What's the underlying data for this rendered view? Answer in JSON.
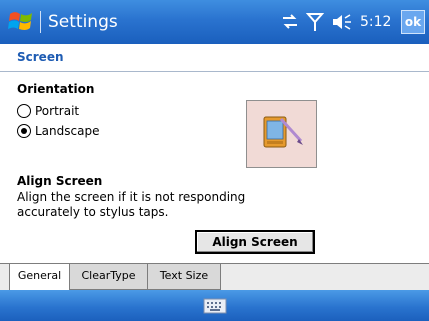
{
  "titlebar": {
    "title": "Settings",
    "time": "5:12",
    "ok_label": "ok",
    "icons": [
      "windows-flag-icon",
      "sync-icon",
      "signal-icon",
      "speaker-icon"
    ],
    "colors": {
      "bar": "#2a73cf",
      "text": "#ffffff"
    }
  },
  "page": {
    "header": "Screen"
  },
  "orientation": {
    "heading": "Orientation",
    "options": [
      {
        "label": "Portrait",
        "checked": false
      },
      {
        "label": "Landscape",
        "checked": true
      }
    ]
  },
  "align": {
    "heading": "Align Screen",
    "description_line1": "Align the screen if it is not responding",
    "description_line2": "accurately to stylus taps.",
    "button_label": "Align Screen"
  },
  "tabs": [
    {
      "label": "General",
      "active": true
    },
    {
      "label": "ClearType",
      "active": false
    },
    {
      "label": "Text Size",
      "active": false
    }
  ],
  "bottombar": {
    "icon": "keyboard-icon"
  }
}
